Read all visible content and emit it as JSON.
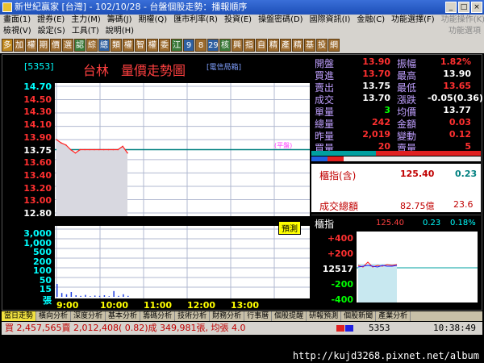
{
  "window": {
    "title": "新世紀贏家 [台灣] - 102/10/28 - 台盤個股走勢：播報順序"
  },
  "menu_row1": {
    "items": [
      "畫面(1)",
      "證券(E)",
      "主力(M)",
      "籌碼(J)",
      "期權(Q)",
      "匯市利率(R)",
      "投資(E)",
      "操盤密碼(D)",
      "國際資訊(I)",
      "金融(C)",
      "功能選擇(F)"
    ],
    "right": "功能操作(K)"
  },
  "menu_row2": {
    "items": [
      "檢視(V)",
      "設定(S)",
      "工具(T)",
      "說明(H)"
    ],
    "right": "功能選項"
  },
  "toolbar": {
    "buttons": [
      "多",
      "加",
      "權",
      "期",
      "價",
      "選",
      "認",
      "綜",
      "總",
      "類",
      "權",
      "智",
      "權",
      "委",
      "江",
      "9",
      "8",
      "29",
      "核",
      "興",
      "指",
      "自",
      "精",
      "產",
      "精",
      "基",
      "投",
      "網"
    ]
  },
  "stock": {
    "code": "[5353]",
    "name": "台林",
    "chart_title": "量價走勢圖",
    "source": "[電信局箱]"
  },
  "price_axis": {
    "labels": [
      "14.70",
      "14.50",
      "14.30",
      "14.10",
      "13.90",
      "13.75",
      "13.60",
      "13.40",
      "13.20",
      "13.00",
      "12.80"
    ],
    "ref_tag": "(平盤)"
  },
  "volume_axis": {
    "labels": [
      "3,000",
      "1,000",
      "500",
      "200",
      "100",
      "50",
      "15",
      "張"
    ]
  },
  "time_axis": {
    "labels": [
      "9:00",
      "10:00",
      "11:00",
      "12:00",
      "13:00"
    ]
  },
  "predict_label": "預測",
  "quote": {
    "rows": [
      {
        "l1": "開盤",
        "v1": "13.90",
        "l2": "振幅",
        "v2": "1.82%"
      },
      {
        "l1": "買進",
        "v1": "13.70",
        "l2": "最高",
        "v2": "13.90"
      },
      {
        "l1": "賣出",
        "v1": "13.75",
        "l2": "最低",
        "v2": "13.65"
      },
      {
        "l1": "成交",
        "v1": "13.70",
        "l2": "漲跌",
        "v2": "-0.05(0.36)"
      },
      {
        "l1": "單量",
        "v1": "3",
        "l2": "均價",
        "v2": "13.77"
      },
      {
        "l1": "總量",
        "v1": "242",
        "l2": "金額",
        "v2": "0.03"
      },
      {
        "l1": "昨量",
        "v1": "2,019",
        "l2": "變動",
        "v2": "0.12"
      },
      {
        "l1": "買量",
        "v1": "20",
        "l2": "賣量",
        "v2": "5"
      }
    ]
  },
  "index_panel": {
    "label": "櫃指(含)",
    "value": "125.40",
    "change": "0.23",
    "total_label": "成交總額",
    "total_value": "82.75億",
    "total_extra": "23.6"
  },
  "mini_chart": {
    "label": "櫃指",
    "value": "125.40",
    "change": "0.23",
    "pct": "0.18%",
    "y_labels": [
      "+400",
      "+200",
      "12517",
      "-200",
      "-400"
    ]
  },
  "bottom_tabs": {
    "items": [
      "當日走勢",
      "橫向分析",
      "深度分析",
      "基本分析",
      "籌碼分析",
      "技術分析",
      "財務分析",
      "行事曆",
      "個股提醒",
      "研報預測",
      "個股新聞",
      "產業分析"
    ]
  },
  "statusbar": {
    "text": "買 2,457,565賣 2,012,408( 0.82)成 349,981張, 均張 4.0",
    "code": "5353",
    "time": "10:38:49"
  },
  "watermark": "http://kujd3268.pixnet.net/album",
  "colors": {
    "up": "#ff3030",
    "down": "#00ff00",
    "flat": "#ffffff",
    "axis_text": "#00ffff",
    "accent": "#ffff00"
  },
  "chart_data": {
    "type": "line",
    "x": [
      "9:00",
      "9:05",
      "9:10",
      "9:15",
      "9:20",
      "9:25",
      "9:30",
      "9:35",
      "9:40",
      "9:45",
      "9:50",
      "9:55",
      "10:00",
      "10:05",
      "10:10",
      "10:15"
    ],
    "series": [
      {
        "values": [
          13.9,
          13.85,
          13.82,
          13.75,
          13.7,
          13.75,
          13.75,
          13.75,
          13.75,
          13.75,
          13.75,
          13.75,
          13.75,
          13.75,
          13.8,
          13.7
        ]
      }
    ],
    "volume": [
      40,
      12,
      8,
      15,
      5,
      3,
      6,
      2,
      4,
      3,
      5,
      2,
      18,
      3,
      8,
      3
    ],
    "ylim": [
      12.8,
      14.7
    ],
    "ref_price": 13.75
  }
}
